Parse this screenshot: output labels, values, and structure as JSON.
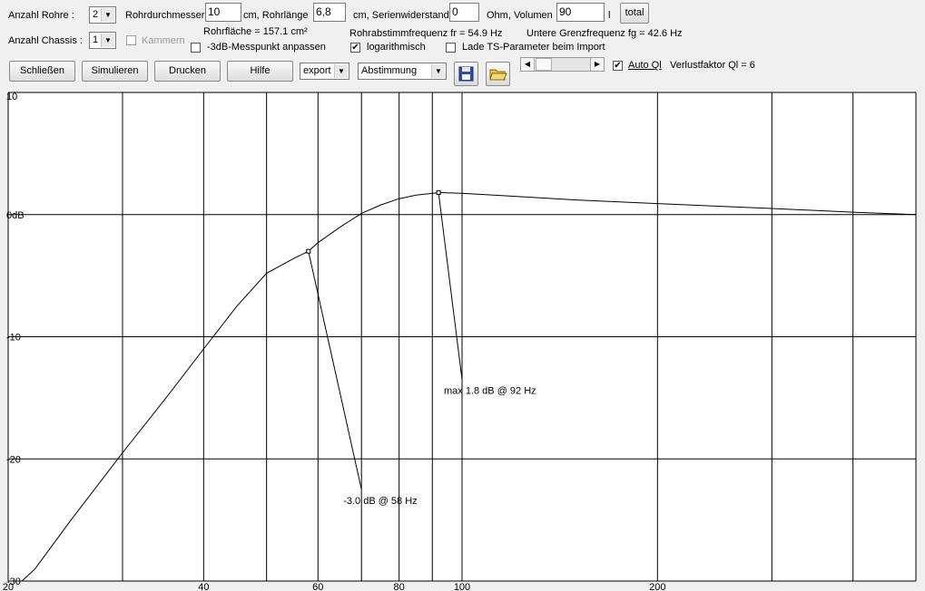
{
  "controls": {
    "anzahl_rohre_label": "Anzahl Rohre :",
    "anzahl_rohre_value": "2",
    "rohrdurchmesser_label": "Rohrdurchmesser",
    "rohrdurchmesser_value": "10",
    "rohrlaenge_label": "cm, Rohrlänge",
    "rohrlaenge_value": "6,8",
    "serienwiderstand_label": "cm, Serienwiderstand",
    "serienwiderstand_value": "0",
    "volumen_label": "Ohm, Volumen",
    "volumen_value": "90",
    "volumen_unit": "l",
    "total_button": "total",
    "anzahl_chassis_label": "Anzahl Chassis :",
    "anzahl_chassis_value": "1",
    "kammern_label": "Kammern",
    "rohrflaeche": "Rohrfläche = 157.1 cm²",
    "messpunkt_label": "-3dB-Messpunkt anpassen",
    "rohrabstimm": "Rohrabstimmfrequenz fr = 54.9 Hz",
    "logarithmisch_label": "logarithmisch",
    "grenzfrequenz": "Untere Grenzfrequenz fg = 42.6 Hz",
    "lade_ts_label": "Lade TS-Parameter beim Import",
    "schliessen_button": "Schließen",
    "simulieren_button": "Simulieren",
    "drucken_button": "Drucken",
    "hilfe_button": "Hilfe",
    "export_value": "export",
    "abstimmung_value": "Abstimmung",
    "auto_ql_label": "Auto Ql",
    "verlustfaktor": "Verlustfaktor Ql = 6",
    "checked_mark": "✔"
  },
  "chart_data": {
    "type": "line",
    "xscale": "log",
    "xlim": [
      20,
      500
    ],
    "ylim": [
      -30,
      10
    ],
    "xticks": [
      {
        "value": 20,
        "label": "20"
      },
      {
        "value": 40,
        "label": "40"
      },
      {
        "value": 60,
        "label": "60"
      },
      {
        "value": 80,
        "label": "80"
      },
      {
        "value": 100,
        "label": "100"
      },
      {
        "value": 200,
        "label": "200"
      }
    ],
    "xgrid": [
      20,
      30,
      40,
      50,
      60,
      70,
      80,
      90,
      100,
      200,
      300,
      400,
      500
    ],
    "yticks": [
      {
        "value": 10,
        "label": "10"
      },
      {
        "value": 0,
        "label": "0dB"
      },
      {
        "value": -10,
        "label": "-10"
      },
      {
        "value": -20,
        "label": "-20"
      },
      {
        "value": -30,
        "label": "-30"
      }
    ],
    "series": [
      {
        "x": [
          21,
          22,
          25,
          30,
          35,
          40,
          45,
          50,
          55,
          58,
          60,
          65,
          70,
          75,
          80,
          85,
          90,
          92,
          100,
          120,
          150,
          200,
          300,
          400,
          500
        ],
        "y": [
          -30,
          -29,
          -25,
          -19.5,
          -15,
          -11,
          -7.5,
          -4.8,
          -3.6,
          -3.0,
          -2.3,
          -1.0,
          0.1,
          0.8,
          1.3,
          1.6,
          1.75,
          1.8,
          1.75,
          1.5,
          1.2,
          0.9,
          0.5,
          0.2,
          0.0
        ]
      }
    ],
    "annotations": [
      {
        "text": "-3.0 dB @  58 Hz",
        "x": 58,
        "y": -3.0,
        "label_x": 70,
        "label_y": -22.5
      },
      {
        "text": "max 1.8 dB @ 92 Hz",
        "x": 92,
        "y": 1.8,
        "label_x": 100,
        "label_y": -13.5
      }
    ]
  }
}
